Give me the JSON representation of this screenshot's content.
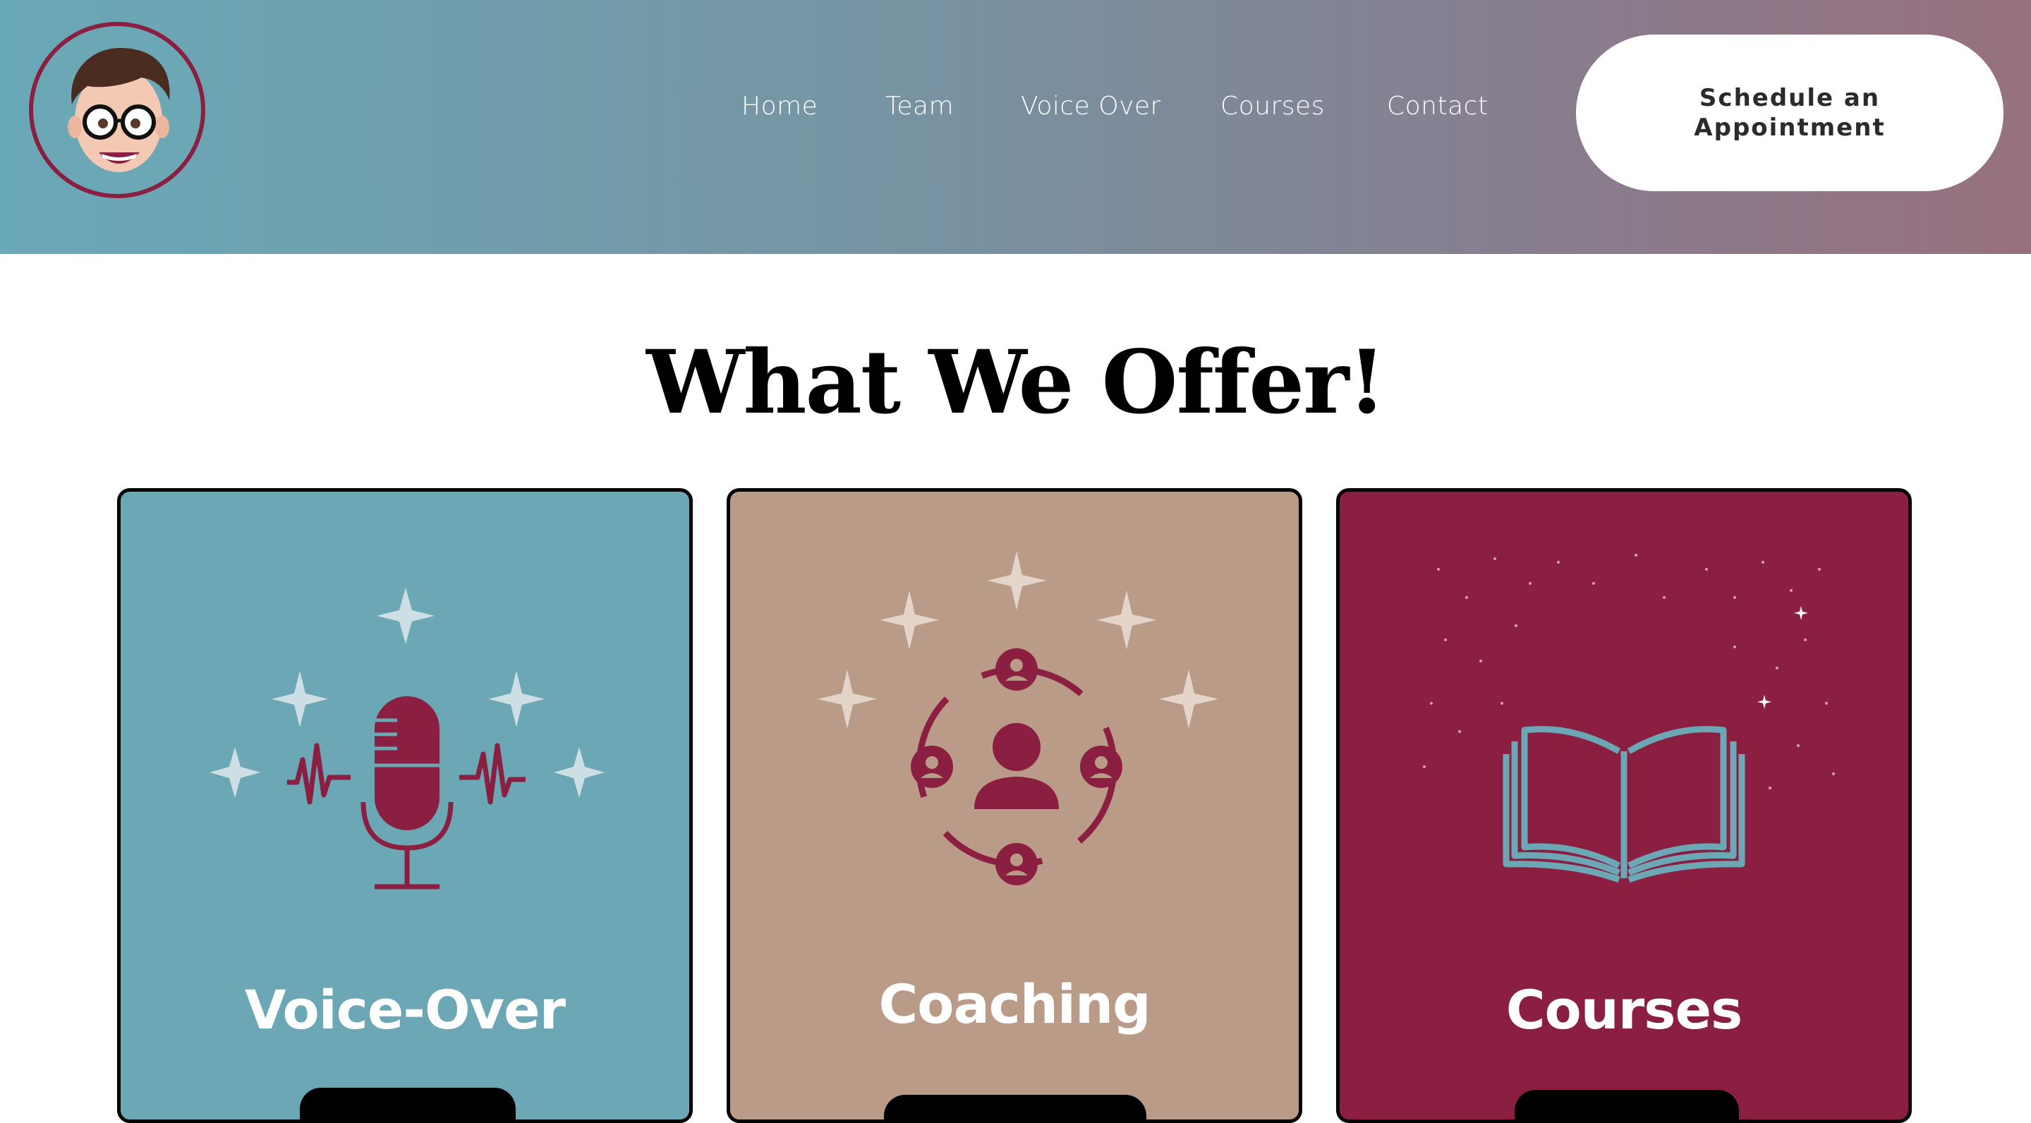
{
  "nav": {
    "items": [
      {
        "label": "Home"
      },
      {
        "label": "Team"
      },
      {
        "label": "Voice Over"
      },
      {
        "label": "Courses"
      },
      {
        "label": "Contact"
      }
    ],
    "cta_line1": "Schedule an",
    "cta_line2": "Appointment"
  },
  "main": {
    "title": "What We Offer!",
    "cards": [
      {
        "title": "Voice-Over",
        "icon": "microphone-icon",
        "bg": "#6ca7b5",
        "icon_color": "#8b1f41"
      },
      {
        "title": "Coaching",
        "icon": "team-network-icon",
        "bg": "#ba9b88",
        "icon_color": "#8b1f41"
      },
      {
        "title": "Courses",
        "icon": "open-book-icon",
        "bg": "#8b1f41",
        "icon_color": "#6ca7b5"
      }
    ]
  },
  "colors": {
    "brand_teal": "#6ca7b5",
    "brand_tan": "#ba9b88",
    "brand_maroon": "#8b1f41"
  }
}
